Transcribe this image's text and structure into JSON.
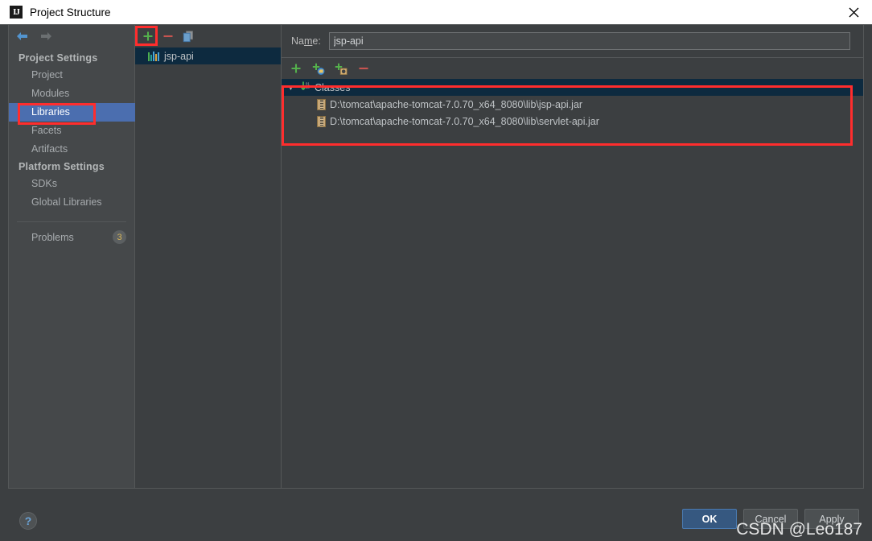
{
  "window": {
    "title": "Project Structure",
    "icon": "intellij-idea-icon",
    "close_icon": "close-icon"
  },
  "nav": {
    "back_icon": "arrow-left-icon",
    "forward_icon": "arrow-right-icon"
  },
  "sidebar": {
    "groups": [
      {
        "title": "Project Settings",
        "items": [
          {
            "label": "Project",
            "selected": false
          },
          {
            "label": "Modules",
            "selected": false
          },
          {
            "label": "Libraries",
            "selected": true
          },
          {
            "label": "Facets",
            "selected": false
          },
          {
            "label": "Artifacts",
            "selected": false
          }
        ]
      },
      {
        "title": "Platform Settings",
        "items": [
          {
            "label": "SDKs",
            "selected": false
          },
          {
            "label": "Global Libraries",
            "selected": false
          }
        ]
      }
    ],
    "problems": {
      "label": "Problems",
      "count": "3"
    }
  },
  "middle_panel": {
    "toolbar": [
      {
        "name": "add-library-button",
        "icon": "plus-icon",
        "label": "+"
      },
      {
        "name": "remove-library-button",
        "icon": "minus-icon",
        "label": "−"
      },
      {
        "name": "copy-library-button",
        "icon": "copy-icon",
        "label": ""
      }
    ],
    "items": [
      {
        "label": "jsp-api",
        "icon": "library-icon",
        "selected": true
      }
    ]
  },
  "detail": {
    "name_label_pre": "Na",
    "name_label_underlined": "m",
    "name_label_post": "e:",
    "name_value": "jsp-api",
    "name_placeholder": "",
    "classes_toolbar": [
      {
        "name": "add-jar-button",
        "icon": "plus-icon"
      },
      {
        "name": "add-jar-directory-button",
        "icon": "plus-folder-icon"
      },
      {
        "name": "add-jar-from-module-button",
        "icon": "plus-jar-icon"
      },
      {
        "name": "remove-root-button",
        "icon": "minus-icon"
      }
    ],
    "tree": {
      "root": {
        "label": "Classes",
        "icon": "classes-root-icon",
        "expander": "▼",
        "expanded": true
      },
      "children": [
        {
          "label": "D:\\tomcat\\apache-tomcat-7.0.70_x64_8080\\lib\\jsp-api.jar",
          "icon": "jar-icon"
        },
        {
          "label": "D:\\tomcat\\apache-tomcat-7.0.70_x64_8080\\lib\\servlet-api.jar",
          "icon": "jar-icon"
        }
      ]
    }
  },
  "footer": {
    "help_icon": "help-question-icon",
    "buttons": [
      {
        "name": "ok-button",
        "label": "OK",
        "primary": true
      },
      {
        "name": "cancel-button",
        "label": "Cancel",
        "primary": false
      },
      {
        "name": "apply-button",
        "label": "Apply",
        "primary": false
      }
    ]
  },
  "watermark": "CSDN @Leo187",
  "colors": {
    "background": "#3c3f41",
    "sidebar": "#45484a",
    "selection_blue": "#4b6eaf",
    "tree_selection": "#0d2a3f",
    "primary_button": "#365880",
    "annotation_red": "#ff2d2d",
    "add_green": "#54b14c",
    "remove_red": "#c75450"
  }
}
